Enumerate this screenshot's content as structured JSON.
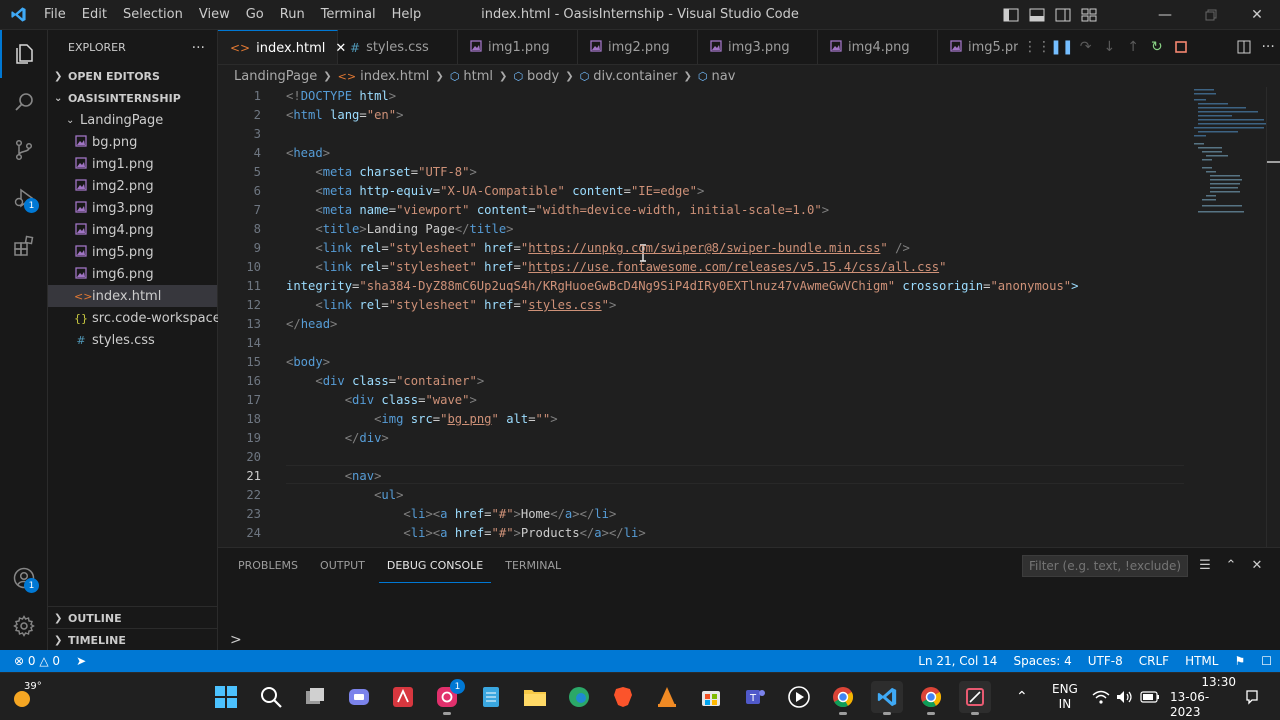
{
  "titlebar": {
    "menu": [
      "File",
      "Edit",
      "Selection",
      "View",
      "Go",
      "Run",
      "Terminal",
      "Help"
    ],
    "title": "index.html - OasisInternship - Visual Studio Code"
  },
  "activity": {
    "debug_badge": "1",
    "accounts_badge": "1"
  },
  "sidebar": {
    "header": "EXPLORER",
    "more": "···",
    "open_editors": "OPEN EDITORS",
    "workspace": "OASISINTERNSHIP",
    "folder": "LandingPage",
    "files": [
      {
        "name": "bg.png",
        "icon": "image"
      },
      {
        "name": "img1.png",
        "icon": "image"
      },
      {
        "name": "img2.png",
        "icon": "image"
      },
      {
        "name": "img3.png",
        "icon": "image"
      },
      {
        "name": "img4.png",
        "icon": "image"
      },
      {
        "name": "img5.png",
        "icon": "image"
      },
      {
        "name": "img6.png",
        "icon": "image"
      }
    ],
    "root_files": [
      {
        "name": "index.html",
        "icon": "<>"
      },
      {
        "name": "src.code-workspace",
        "icon": "{}"
      },
      {
        "name": "styles.css",
        "icon": "#"
      }
    ],
    "outline": "OUTLINE",
    "timeline": "TIMELINE"
  },
  "tabs": [
    {
      "label": "index.html",
      "icon": "<>"
    },
    {
      "label": "styles.css",
      "icon": "#"
    },
    {
      "label": "img1.png",
      "icon": "image"
    },
    {
      "label": "img2.png",
      "icon": "image"
    },
    {
      "label": "img3.png",
      "icon": "image"
    },
    {
      "label": "img4.png",
      "icon": "image"
    },
    {
      "label": "img5.pr",
      "icon": "image"
    }
  ],
  "breadcrumb": [
    "LandingPage",
    "index.html",
    "html",
    "body",
    "div.container",
    "nav"
  ],
  "editor": {
    "current_line": 21,
    "lines": [
      {
        "n": "1",
        "c": "<!DOCTYPE html>"
      },
      {
        "n": "2",
        "c": "<html lang=\"en\">"
      },
      {
        "n": "3",
        "c": ""
      },
      {
        "n": "4",
        "c": "<head>"
      },
      {
        "n": "5",
        "c": "    <meta charset=\"UTF-8\">"
      },
      {
        "n": "6",
        "c": "    <meta http-equiv=\"X-UA-Compatible\" content=\"IE=edge\">"
      },
      {
        "n": "7",
        "c": "    <meta name=\"viewport\" content=\"width=device-width, initial-scale=1.0\">"
      },
      {
        "n": "8",
        "c": "    <title>Landing Page</title>"
      },
      {
        "n": "9",
        "c": "    <link rel=\"stylesheet\" href=\"https://unpkg.com/swiper@8/swiper-bundle.min.css\" />"
      },
      {
        "n": "10",
        "c": "    <link rel=\"stylesheet\" href=\"https://use.fontawesome.com/releases/v5.15.4/css/all.css\""
      },
      {
        "n": "11",
        "c": "integrity=\"sha384-DyZ88mC6Up2uqS4h/KRgHuoeGwBcD4Ng9SiP4dIRy0EXTlnuz47vAwmeGwVChigm\" crossorigin=\"anonymous\">"
      },
      {
        "n": "12",
        "c": "    <link rel=\"stylesheet\" href=\"styles.css\">"
      },
      {
        "n": "13",
        "c": "</head>"
      },
      {
        "n": "14",
        "c": ""
      },
      {
        "n": "15",
        "c": "<body>"
      },
      {
        "n": "16",
        "c": "    <div class=\"container\">"
      },
      {
        "n": "17",
        "c": "        <div class=\"wave\">"
      },
      {
        "n": "18",
        "c": "            <img src=\"bg.png\" alt=\"\">"
      },
      {
        "n": "19",
        "c": "        </div>"
      },
      {
        "n": "20",
        "c": ""
      },
      {
        "n": "21",
        "c": "        <nav>"
      },
      {
        "n": "22",
        "c": "            <ul>"
      },
      {
        "n": "23",
        "c": "                <li><a href=\"#\">Home</a></li>"
      },
      {
        "n": "24",
        "c": "                <li><a href=\"#\">Products</a></li>"
      }
    ]
  },
  "panel": {
    "tabs": [
      "PROBLEMS",
      "OUTPUT",
      "DEBUG CONSOLE",
      "TERMINAL"
    ],
    "active": "DEBUG CONSOLE",
    "filter_placeholder": "Filter (e.g. text, !exclude)",
    "prompt": ">"
  },
  "status": {
    "errors": "0",
    "warnings": "0",
    "position": "Ln 21, Col 14",
    "spaces": "Spaces: 4",
    "encoding": "UTF-8",
    "eol": "CRLF",
    "language": "HTML"
  },
  "taskbar": {
    "temperature": "39°",
    "lang1": "ENG",
    "lang2": "IN",
    "time": "13:30",
    "date": "13-06-2023",
    "instagram_badge": "1"
  },
  "colors": {
    "accent": "#0078d4",
    "tag": "#569cd6",
    "attribute": "#9cdcfe",
    "string": "#ce9178",
    "bracket": "#808080"
  }
}
